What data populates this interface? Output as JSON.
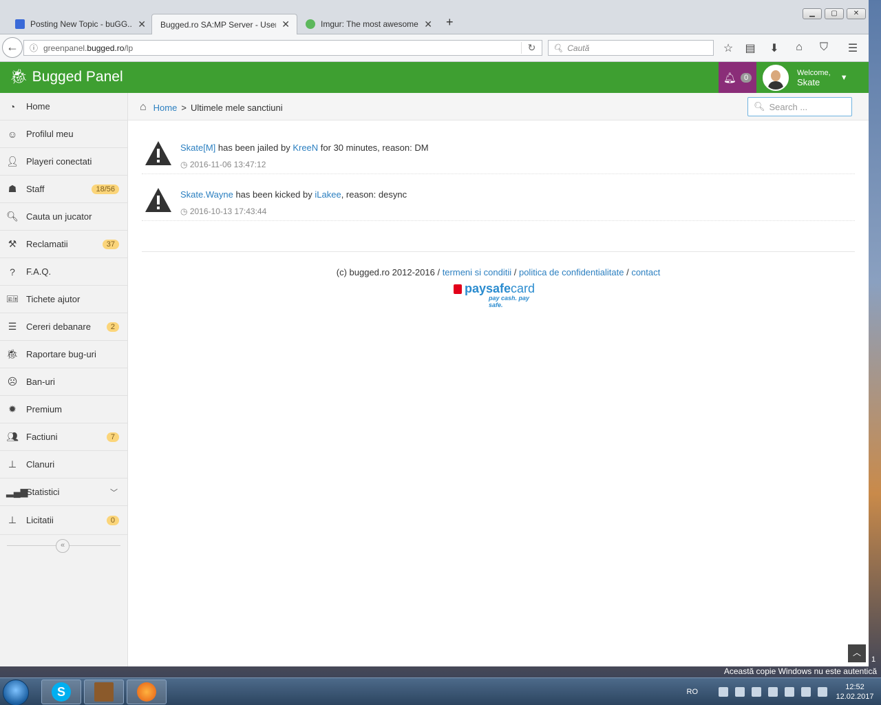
{
  "browser": {
    "tabs": [
      {
        "title": "Posting New Topic - buGG...",
        "active": false,
        "favicon_color": "#3a6ad8"
      },
      {
        "title": "Bugged.ro SA:MP Server - User ...",
        "active": true,
        "favicon_color": "#ffffff"
      },
      {
        "title": "Imgur: The most awesome...",
        "active": false,
        "favicon_color": "#5cb85c"
      }
    ],
    "new_tab_label": "+",
    "url_prefix": "greenpanel.",
    "url_domain": "bugged.ro",
    "url_path": "/lp",
    "search_placeholder": "Caută"
  },
  "panel": {
    "brand": "Bugged Panel",
    "notifications_count": "0",
    "welcome_label": "Welcome,",
    "username": "Skate",
    "accent_color": "#3e9f31",
    "notif_color": "#8a2d78"
  },
  "sidebar": {
    "items": [
      {
        "label": "Home",
        "icon": "dashboard-icon",
        "badge": ""
      },
      {
        "label": "Profilul meu",
        "icon": "smile-icon",
        "badge": ""
      },
      {
        "label": "Playeri conectati",
        "icon": "user-icon",
        "badge": ""
      },
      {
        "label": "Staff",
        "icon": "android-icon",
        "badge": "18/56"
      },
      {
        "label": "Cauta un jucator",
        "icon": "search-icon",
        "badge": ""
      },
      {
        "label": "Reclamatii",
        "icon": "gavel-icon",
        "badge": "37"
      },
      {
        "label": "F.A.Q.",
        "icon": "question-icon",
        "badge": ""
      },
      {
        "label": "Tichete ajutor",
        "icon": "ticket-icon",
        "badge": ""
      },
      {
        "label": "Cereri debanare",
        "icon": "list-icon",
        "badge": "2"
      },
      {
        "label": "Raportare bug-uri",
        "icon": "bug-icon",
        "badge": ""
      },
      {
        "label": "Ban-uri",
        "icon": "frown-icon",
        "badge": ""
      },
      {
        "label": "Premium",
        "icon": "certificate-icon",
        "badge": ""
      },
      {
        "label": "Factiuni",
        "icon": "users-icon",
        "badge": "7"
      },
      {
        "label": "Clanuri",
        "icon": "sitemap-icon",
        "badge": ""
      },
      {
        "label": "Statistici",
        "icon": "signal-icon",
        "badge": ""
      },
      {
        "label": "Licitatii",
        "icon": "sitemap-icon",
        "badge": "0"
      }
    ]
  },
  "breadcrumb": {
    "home": "Home",
    "separator": ">",
    "current": "Ultimele mele sanctiuni"
  },
  "search": {
    "placeholder": "Search ..."
  },
  "sanctions": [
    {
      "player": "Skate[M]",
      "action": " has been jailed by ",
      "admin": "KreeN",
      "details": " for 30 minutes, reason: DM",
      "timestamp": "2016-11-06 13:47:12"
    },
    {
      "player": "Skate.Wayne",
      "action": " has been kicked by ",
      "admin": "iLakee",
      "details": ", reason: desync",
      "timestamp": "2016-10-13 17:43:44"
    }
  ],
  "footer": {
    "copyright": "(c) bugged.ro 2012-2016 / ",
    "terms": "termeni si conditii",
    "sep1": " / ",
    "privacy": "politica de confidentialitate",
    "sep2": " / ",
    "contact": "contact",
    "paysafe_a": "paysafe",
    "paysafe_b": "card",
    "paysafe_tagline": "pay cash. pay safe."
  },
  "os": {
    "watermark": "Această copie Windows nu este autentică",
    "lang": "RO",
    "time": "12:52",
    "date": "12.02.2017",
    "side_number": "1"
  }
}
